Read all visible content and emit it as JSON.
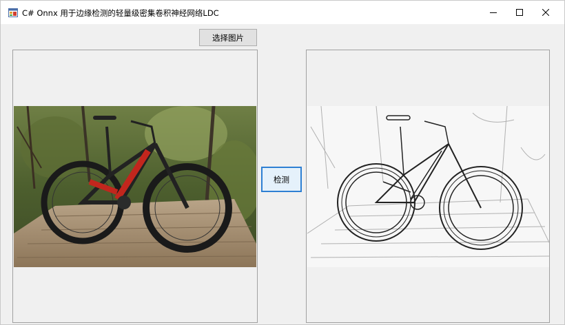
{
  "window": {
    "title": "C# Onnx 用于边缘检测的轻量级密集卷积神经网络LDC",
    "icons": {
      "app": "app-window-icon",
      "minimize": "minimize-icon",
      "maximize": "maximize-icon",
      "close": "close-icon"
    }
  },
  "buttons": {
    "select_image": "选择图片",
    "detect": "检测"
  },
  "images": {
    "source": "photo-of-red-black-mountain-bike-on-wooden-boardwalk",
    "result": "edge-map-of-mountain-bike"
  },
  "colors": {
    "window_bg": "#f0f0f0",
    "focus_border": "#2d7fd3",
    "button_bg": "#e1e1e1"
  }
}
